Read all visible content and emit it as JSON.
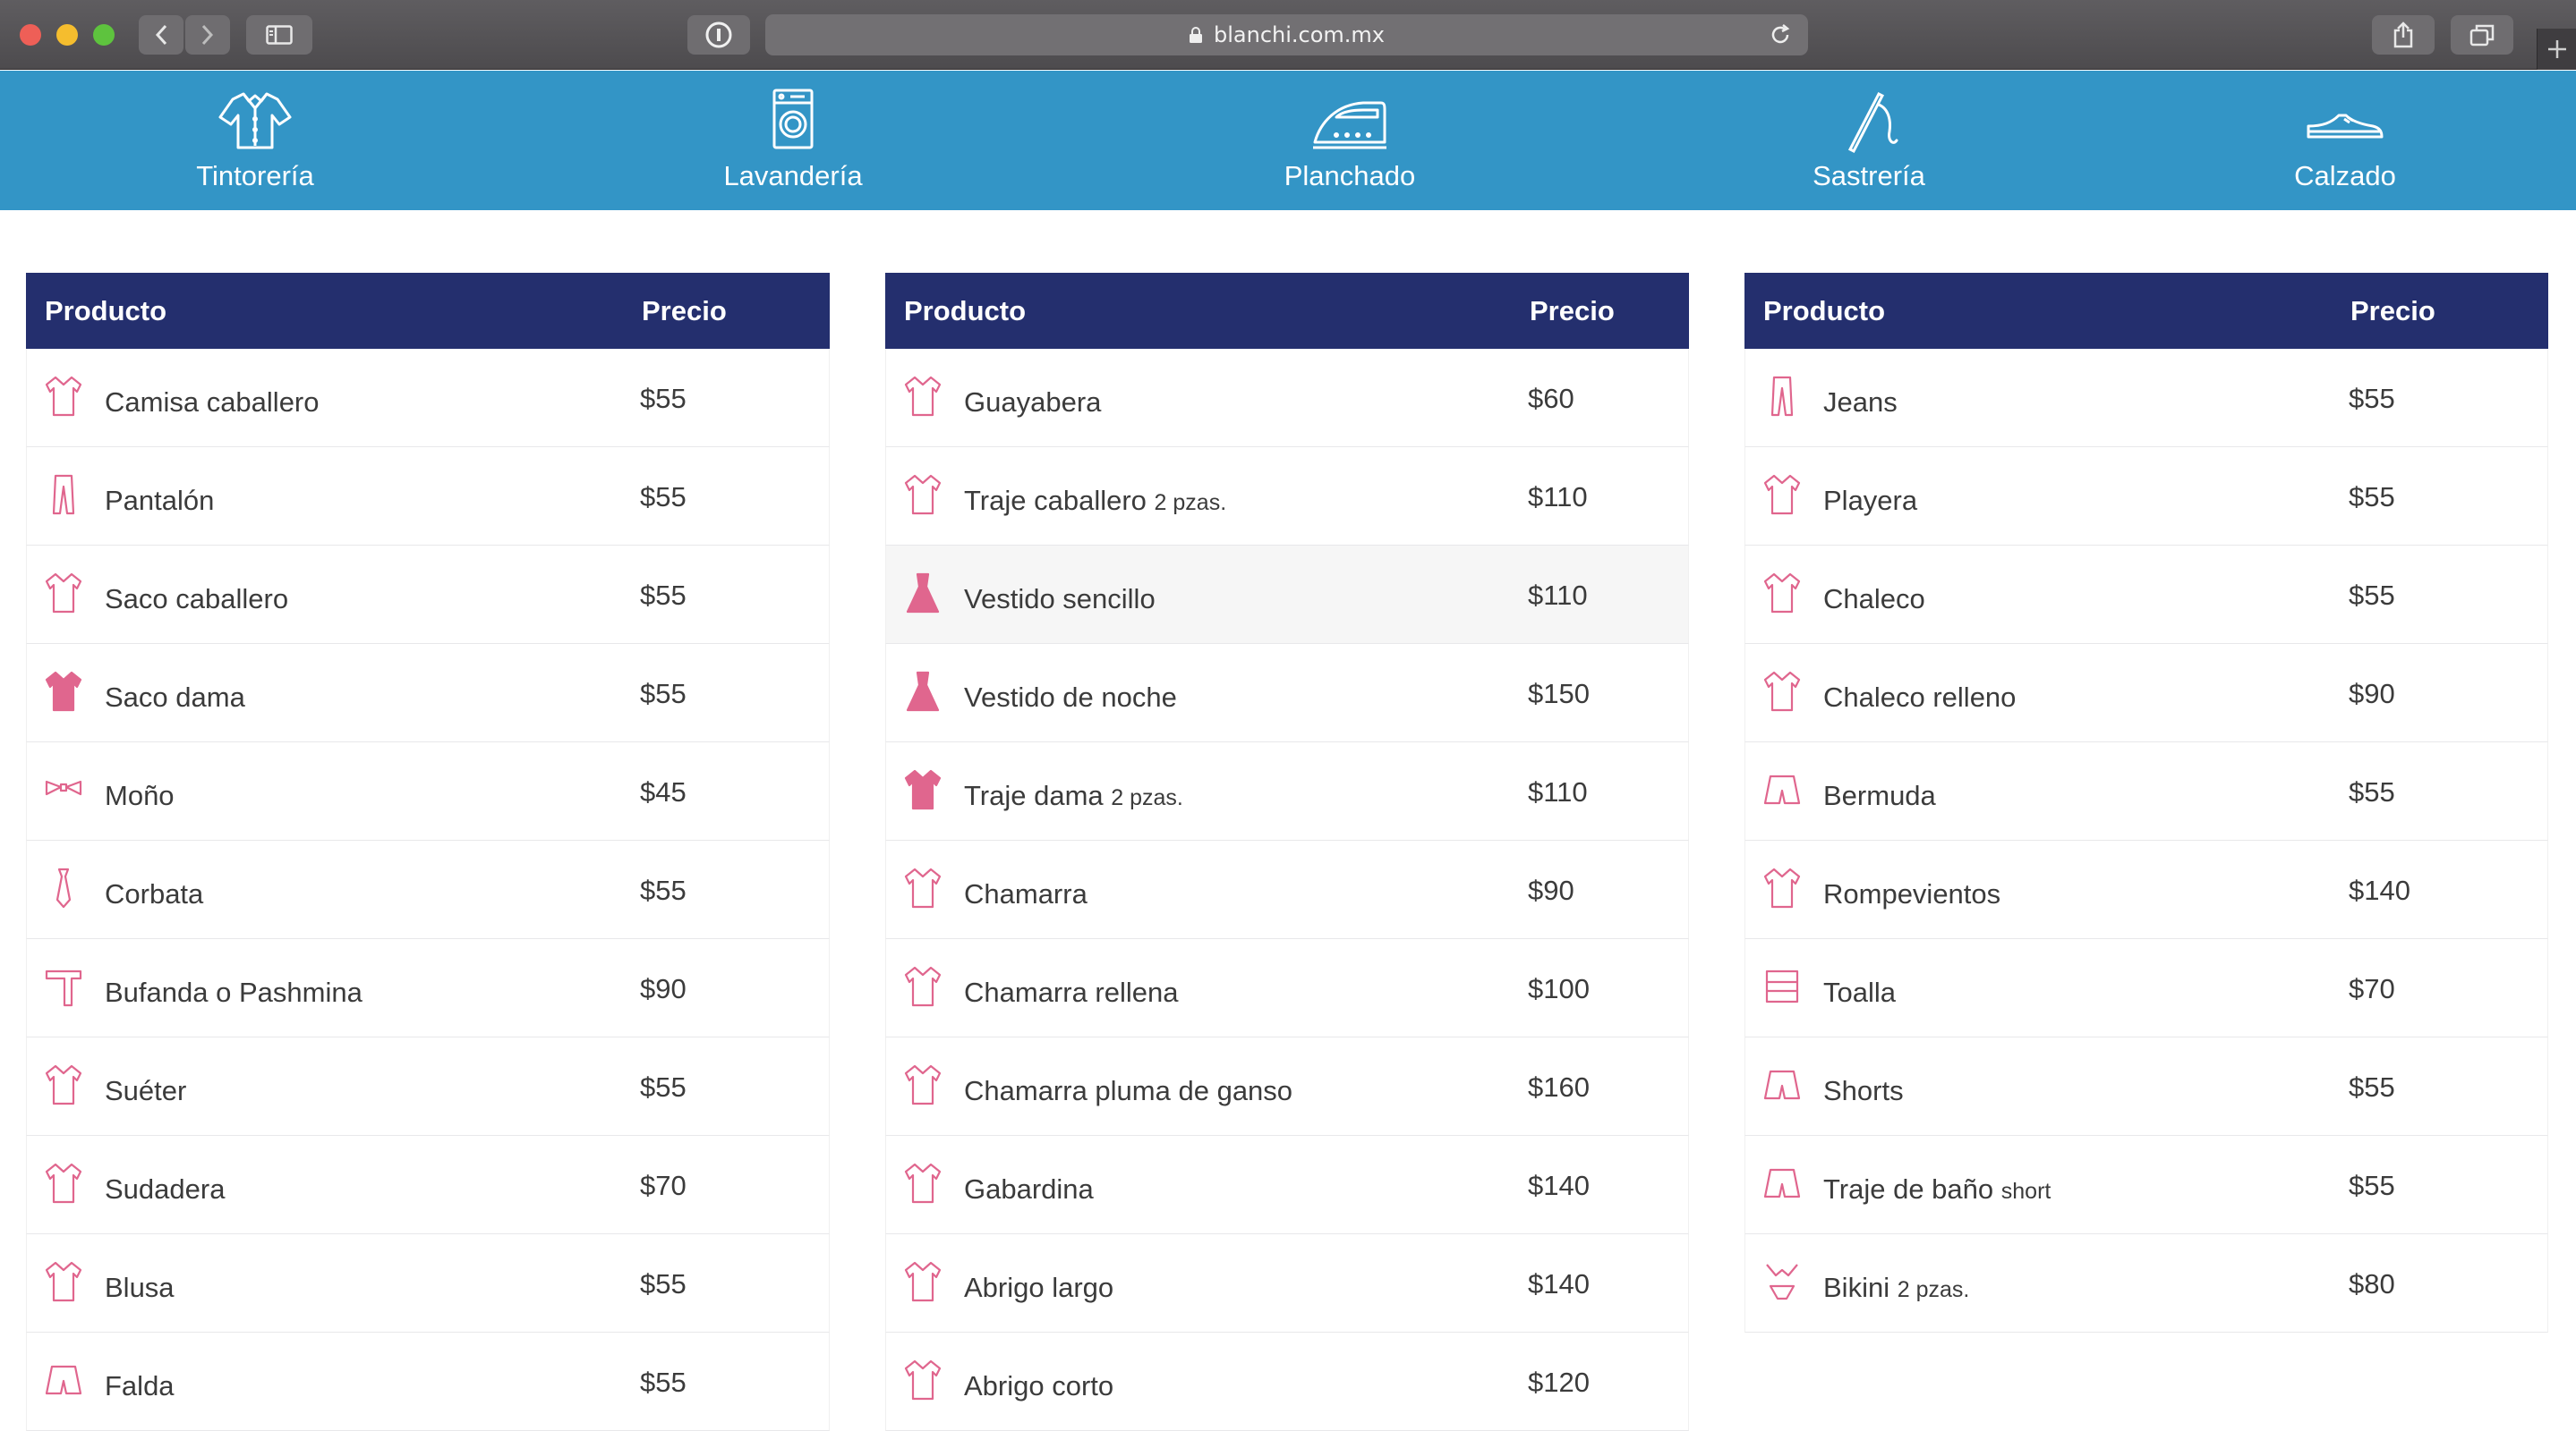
{
  "browser": {
    "url": "blanchi.com.mx"
  },
  "services": [
    {
      "label": "Tintorería",
      "icon": "shirt-icon"
    },
    {
      "label": "Lavandería",
      "icon": "washing-machine-icon"
    },
    {
      "label": "Planchado",
      "icon": "iron-icon"
    },
    {
      "label": "Sastrería",
      "icon": "needle-icon"
    },
    {
      "label": "Calzado",
      "icon": "shoe-icon"
    }
  ],
  "tables": [
    {
      "header": {
        "product": "Producto",
        "price": "Precio"
      },
      "rows": [
        {
          "name": "Camisa caballero",
          "note": "",
          "price": "$55",
          "icon": "shirt-icon"
        },
        {
          "name": "Pantalón",
          "note": "",
          "price": "$55",
          "icon": "pants-icon"
        },
        {
          "name": "Saco caballero",
          "note": "",
          "price": "$55",
          "icon": "suit-jacket-icon"
        },
        {
          "name": "Saco dama",
          "note": "",
          "price": "$55",
          "icon": "women-jacket-icon"
        },
        {
          "name": "Moño",
          "note": "",
          "price": "$45",
          "icon": "bow-tie-icon"
        },
        {
          "name": "Corbata",
          "note": "",
          "price": "$55",
          "icon": "tie-icon"
        },
        {
          "name": "Bufanda o Pashmina",
          "note": "",
          "price": "$90",
          "icon": "scarf-icon"
        },
        {
          "name": "Suéter",
          "note": "",
          "price": "$55",
          "icon": "sweater-icon"
        },
        {
          "name": "Sudadera",
          "note": "",
          "price": "$70",
          "icon": "hoodie-icon"
        },
        {
          "name": "Blusa",
          "note": "",
          "price": "$55",
          "icon": "blouse-icon"
        },
        {
          "name": "Falda",
          "note": "",
          "price": "$55",
          "icon": "skirt-icon"
        }
      ]
    },
    {
      "header": {
        "product": "Producto",
        "price": "Precio"
      },
      "rows": [
        {
          "name": "Guayabera",
          "note": "",
          "price": "$60",
          "icon": "guayabera-icon"
        },
        {
          "name": "Traje caballero",
          "note": "2 pzas.",
          "price": "$110",
          "icon": "suit-icon"
        },
        {
          "name": "Vestido sencillo",
          "note": "",
          "price": "$110",
          "icon": "dress-icon"
        },
        {
          "name": "Vestido de noche",
          "note": "",
          "price": "$150",
          "icon": "evening-dress-icon"
        },
        {
          "name": "Traje dama",
          "note": "2 pzas.",
          "price": "$110",
          "icon": "women-suit-icon"
        },
        {
          "name": "Chamarra",
          "note": "",
          "price": "$90",
          "icon": "jacket-icon"
        },
        {
          "name": "Chamarra rellena",
          "note": "",
          "price": "$100",
          "icon": "padded-jacket-icon"
        },
        {
          "name": "Chamarra pluma de ganso",
          "note": "",
          "price": "$160",
          "icon": "down-jacket-icon"
        },
        {
          "name": "Gabardina",
          "note": "",
          "price": "$140",
          "icon": "trench-coat-icon"
        },
        {
          "name": "Abrigo largo",
          "note": "",
          "price": "$140",
          "icon": "long-coat-icon"
        },
        {
          "name": "Abrigo corto",
          "note": "",
          "price": "$120",
          "icon": "short-coat-icon"
        }
      ]
    },
    {
      "header": {
        "product": "Producto",
        "price": "Precio"
      },
      "rows": [
        {
          "name": "Jeans",
          "note": "",
          "price": "$55",
          "icon": "jeans-icon"
        },
        {
          "name": "Playera",
          "note": "",
          "price": "$55",
          "icon": "tshirt-icon"
        },
        {
          "name": "Chaleco",
          "note": "",
          "price": "$55",
          "icon": "vest-icon"
        },
        {
          "name": "Chaleco relleno",
          "note": "",
          "price": "$90",
          "icon": "padded-vest-icon"
        },
        {
          "name": "Bermuda",
          "note": "",
          "price": "$55",
          "icon": "bermuda-icon"
        },
        {
          "name": "Rompevientos",
          "note": "",
          "price": "$140",
          "icon": "windbreaker-icon"
        },
        {
          "name": "Toalla",
          "note": "",
          "price": "$70",
          "icon": "towel-icon"
        },
        {
          "name": "Shorts",
          "note": "",
          "price": "$55",
          "icon": "shorts-icon"
        },
        {
          "name": "Traje de baño",
          "note": "short",
          "price": "$55",
          "icon": "swim-trunks-icon"
        },
        {
          "name": "Bikini",
          "note": "2 pzas.",
          "price": "$80",
          "icon": "bikini-icon"
        }
      ]
    }
  ],
  "colors": {
    "nav": "#3395c6",
    "table_header": "#242f6e",
    "icon": "#e0668e"
  }
}
